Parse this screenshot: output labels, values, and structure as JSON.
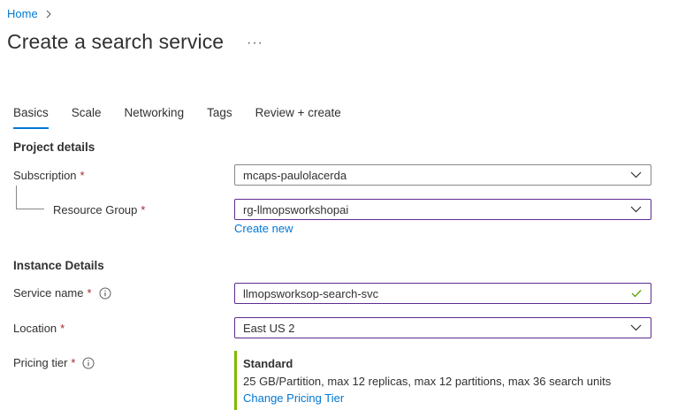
{
  "breadcrumb": {
    "home": "Home"
  },
  "page": {
    "title": "Create a search service",
    "more": "···"
  },
  "tabs": [
    {
      "label": "Basics",
      "active": true
    },
    {
      "label": "Scale"
    },
    {
      "label": "Networking"
    },
    {
      "label": "Tags"
    },
    {
      "label": "Review + create"
    }
  ],
  "project_details": {
    "title": "Project details",
    "subscription": {
      "label": "Subscription",
      "required": "*",
      "value": "mcaps-paulolacerda"
    },
    "resource_group": {
      "label": "Resource Group",
      "required": "*",
      "value": "rg-llmopsworkshopai",
      "create_new": "Create new"
    }
  },
  "instance_details": {
    "title": "Instance Details",
    "service_name": {
      "label": "Service name",
      "required": "*",
      "value": "llmopsworksop-search-svc"
    },
    "location": {
      "label": "Location",
      "required": "*",
      "value": "East US 2"
    },
    "pricing_tier": {
      "label": "Pricing tier",
      "required": "*",
      "tier": "Standard",
      "description": "25 GB/Partition, max 12 replicas, max 12 partitions, max 36 search units",
      "change_link": "Change Pricing Tier"
    }
  },
  "colors": {
    "accent": "#0078d4",
    "required": "#a4262c",
    "focus_border": "#5c2d91",
    "valid": "#7fba00"
  }
}
